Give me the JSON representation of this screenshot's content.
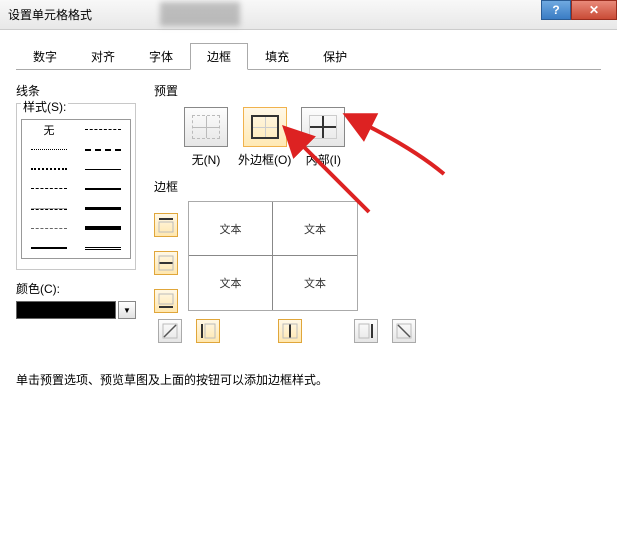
{
  "window": {
    "title": "设置单元格格式"
  },
  "tabs": [
    "数字",
    "对齐",
    "字体",
    "边框",
    "填充",
    "保护"
  ],
  "active_tab": 3,
  "line": {
    "group": "线条",
    "style_label": "样式(S):",
    "none_label": "无",
    "color_label": "颜色(C):"
  },
  "presets": {
    "group": "预置",
    "items": [
      {
        "label": "无(N)"
      },
      {
        "label": "外边框(O)"
      },
      {
        "label": "内部(I)"
      }
    ]
  },
  "border": {
    "group": "边框",
    "sample_text": "文本"
  },
  "hint": "单击预置选项、预览草图及上面的按钮可以添加边框样式。"
}
